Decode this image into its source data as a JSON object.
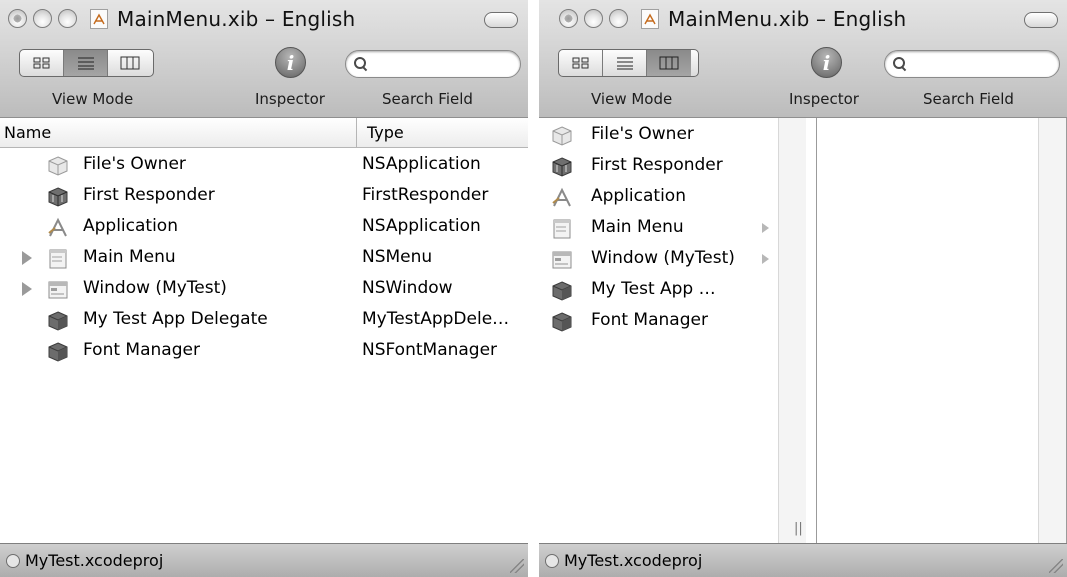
{
  "windows": [
    {
      "title": "MainMenu.xib – English",
      "view_mode_label": "View Mode",
      "inspector_label": "Inspector",
      "search_label": "Search Field",
      "search_value": "",
      "active_view_mode": "list",
      "columns": {
        "name": "Name",
        "type": "Type"
      },
      "rows": [
        {
          "name": "File's Owner",
          "type": "NSApplication",
          "icon": "files-owner-cube-icon",
          "expandable": false
        },
        {
          "name": "First Responder",
          "type": "FirstResponder",
          "icon": "first-responder-cube-icon",
          "expandable": false
        },
        {
          "name": "Application",
          "type": "NSApplication",
          "icon": "application-icon",
          "expandable": false
        },
        {
          "name": "Main Menu",
          "type": "NSMenu",
          "icon": "menu-icon",
          "expandable": true
        },
        {
          "name": "Window (MyTest)",
          "type": "NSWindow",
          "icon": "window-icon",
          "expandable": true
        },
        {
          "name": "My Test App Delegate",
          "type": "MyTestAppDele…",
          "icon": "object-cube-icon",
          "expandable": false
        },
        {
          "name": "Font Manager",
          "type": "NSFontManager",
          "icon": "object-cube-icon",
          "expandable": false
        }
      ],
      "status": "MyTest.xcodeproj"
    },
    {
      "title": "MainMenu.xib – English",
      "view_mode_label": "View Mode",
      "inspector_label": "Inspector",
      "search_label": "Search Field",
      "search_value": "",
      "active_view_mode": "columns",
      "rows": [
        {
          "name": "File's Owner",
          "icon": "files-owner-cube-icon",
          "expandable": false
        },
        {
          "name": "First Responder",
          "icon": "first-responder-cube-icon",
          "expandable": false
        },
        {
          "name": "Application",
          "icon": "application-icon",
          "expandable": false
        },
        {
          "name": "Main Menu",
          "icon": "menu-icon",
          "expandable": true
        },
        {
          "name": "Window (MyTest)",
          "icon": "window-icon",
          "expandable": true
        },
        {
          "name": "My Test App …",
          "icon": "object-cube-icon",
          "expandable": false
        },
        {
          "name": "Font Manager",
          "icon": "object-cube-icon",
          "expandable": false
        }
      ],
      "column_resize_glyph": "||",
      "status": "MyTest.xcodeproj"
    }
  ]
}
